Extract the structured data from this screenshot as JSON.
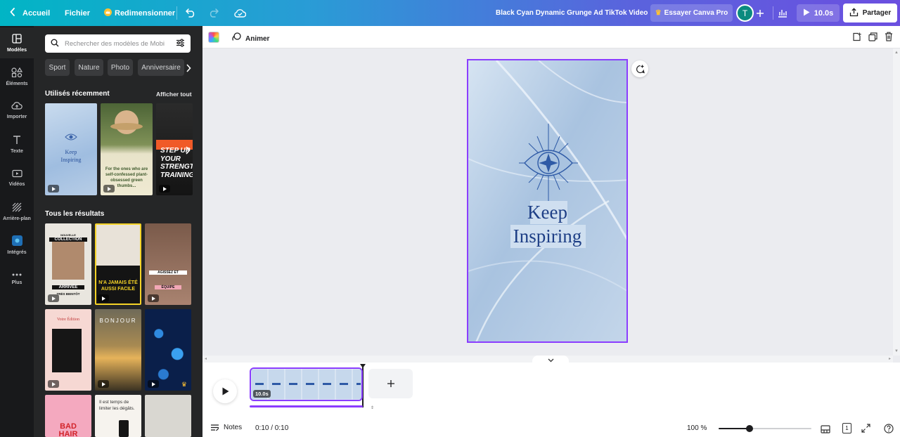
{
  "topbar": {
    "home_label": "Accueil",
    "file_label": "Fichier",
    "resize_label": "Redimensionner",
    "doc_title": "Black Cyan Dynamic Grunge Ad TikTok Video",
    "pro_label": "Essayer Canva Pro",
    "avatar_initial": "T",
    "duration_label": "10.0s",
    "share_label": "Partager"
  },
  "rail": {
    "items": [
      {
        "label": "Modèles"
      },
      {
        "label": "Éléments"
      },
      {
        "label": "Importer"
      },
      {
        "label": "Texte"
      },
      {
        "label": "Vidéos"
      },
      {
        "label": "Arrière-plan"
      },
      {
        "label": "Intégrés"
      },
      {
        "label": "Plus"
      }
    ]
  },
  "panel": {
    "search_placeholder": "Rechercher des modèles de Mobi",
    "chips": [
      "Sport",
      "Nature",
      "Photo",
      "Anniversaire"
    ],
    "recent_title": "Utilisés récemment",
    "see_all": "Afficher tout",
    "recent": [
      {
        "line1": "Keep",
        "line2": "Inspiring"
      },
      {
        "text": "For the ones who are self-confessed plant-obsessed green thumbs..."
      },
      {
        "line1": "STEP UP",
        "line2": "YOUR",
        "line3": "STRENGTH",
        "line4": "TRAINING"
      }
    ],
    "all_title": "Tous les résultats",
    "results": [
      {
        "t1": "NOUVELLE",
        "t2": "COLLECTION",
        "t3": "ARRIVÉE",
        "t4": "TRÈS BIENTÔT"
      },
      {
        "t1": "N'A JAMAIS ÉTÉ",
        "t2": "AUSSI FACILE"
      },
      {
        "t1": "AGISSEZ ET",
        "t2": "ÉQUIPE"
      },
      {
        "t1": "Votre Édition"
      },
      {
        "t1": "BONJOUR"
      },
      {},
      {
        "t1": "BAD",
        "t2": "HAIR"
      },
      {
        "t1": "Il est temps de limiter les dégâts."
      },
      {}
    ]
  },
  "toolbar": {
    "animate_label": "Animer"
  },
  "design": {
    "line1": "Keep",
    "line2": "Inspiring",
    "accent": "#8b3dff"
  },
  "timeline": {
    "clip_duration": "10.0s",
    "notes_label": "Notes",
    "time_label": "0:10 / 0:10",
    "zoom_label": "100 %",
    "page_count": "1",
    "zoom_level": 0.33
  }
}
